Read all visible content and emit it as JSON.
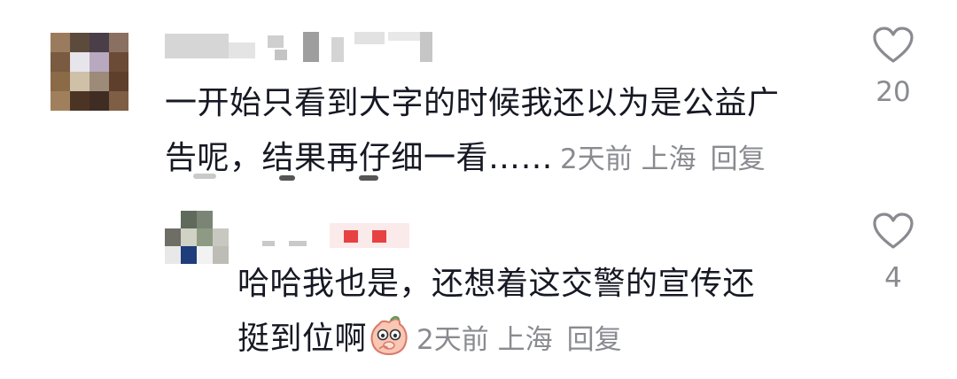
{
  "comments": [
    {
      "text_line1": "一开始只看到大字的时候我还以为是公益广",
      "text_line2": "告呢，结果再仔细一看……",
      "time": "2天前",
      "location": "上海",
      "reply_label": "回复",
      "like_count": "20",
      "icons": {
        "avatar": "avatar-blurred",
        "like": "heart-outline-icon"
      }
    },
    {
      "text_line1": "哈哈我也是，还想着这交警的宣传还",
      "text_line2": "挺到位啊",
      "emoji": "peach-face-emoji",
      "time": "2天前",
      "location": "上海",
      "reply_label": "回复",
      "like_count": "4",
      "icons": {
        "avatar": "avatar-blurred",
        "like": "heart-outline-icon"
      }
    }
  ],
  "colors": {
    "text": "#161823",
    "meta": "#8a8b91",
    "username_blur": "#d9d9d9",
    "badge_red": "#e84141"
  }
}
